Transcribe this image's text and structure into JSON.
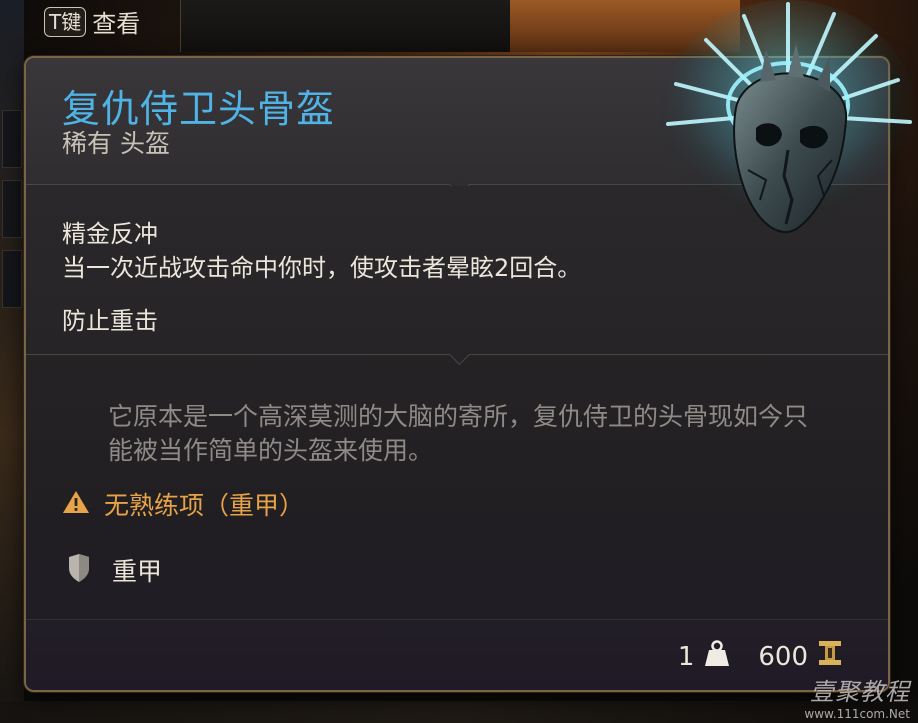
{
  "hint": {
    "key": "T键",
    "action": "查看"
  },
  "item": {
    "name": "复仇侍卫头骨盔",
    "rarity_type": "稀有 头盔",
    "effect_name": "精金反冲",
    "effect_desc": "当一次近战攻击命中你时，使攻击者晕眩2回合。",
    "passive": "防止重击",
    "flavor": "它原本是一个高深莫测的大脑的寄所，复仇侍卫的头骨现如今只能被当作简单的头盔来使用。",
    "warning": "无熟练项（重甲）",
    "proficiency": "重甲",
    "weight": "1",
    "value": "600"
  },
  "watermark": {
    "main": "壹聚教程",
    "url": "www.111com.Net"
  },
  "icons": {
    "warning": "warning-icon",
    "armor": "armor-shield-icon",
    "weight": "weight-icon",
    "gold": "gold-coin-icon",
    "helmet": "helmet-art"
  },
  "colors": {
    "title": "#4fb3e6",
    "warning": "#e6a347",
    "border": "#7a6446",
    "glow": "#5fe0f0"
  }
}
